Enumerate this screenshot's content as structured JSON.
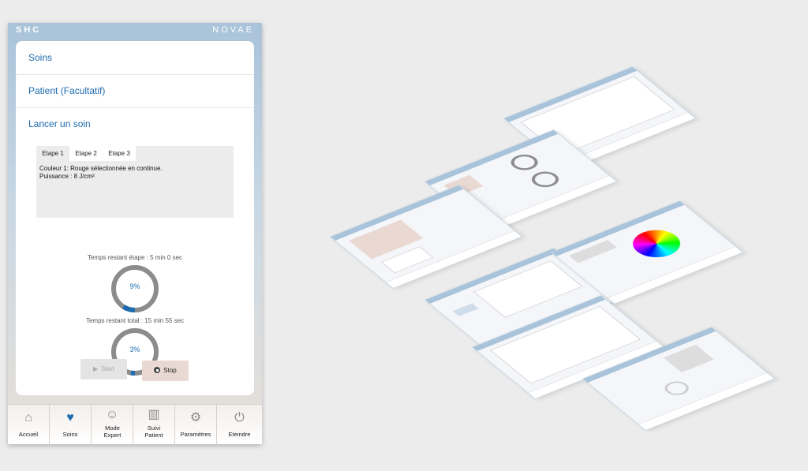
{
  "brand": {
    "left": "SHC",
    "right": "NOVAE"
  },
  "accordion": {
    "soins": "Soins",
    "patient": "Patient (Facultatif)",
    "lancer": "Lancer un soin"
  },
  "tabs": [
    "Etape 1",
    "Etape 2",
    "Etape 3"
  ],
  "tab_body": {
    "line1": "Couleur 1: Rouge sélectionnée en continue.",
    "line2": "Puissance : 8 J/cm²"
  },
  "timer_step": {
    "label": "Temps restant étape : 5 min 0 sec",
    "percent_text": "9%",
    "progress": 0.09
  },
  "timer_total": {
    "label": "Temps restant total : 15 min 55 sec",
    "percent_text": "3%",
    "progress": 0.03
  },
  "buttons": {
    "start": "Start",
    "stop": "Stop"
  },
  "nav": [
    {
      "label": "Accueil",
      "icon": "home-icon"
    },
    {
      "label": "Soins",
      "icon": "heart-pulse-icon"
    },
    {
      "label": "Mode Expert",
      "icon": "expert-user-icon"
    },
    {
      "label": "Suivi Patient",
      "icon": "chart-icon"
    },
    {
      "label": "Paramètres",
      "icon": "gears-icon"
    },
    {
      "label": "Eteindre",
      "icon": "power-icon"
    }
  ],
  "colors": {
    "accent": "#1e6bb0",
    "header": "#a9c3da",
    "progress": "#1e6bb0",
    "ring": "#8c8c8c"
  }
}
